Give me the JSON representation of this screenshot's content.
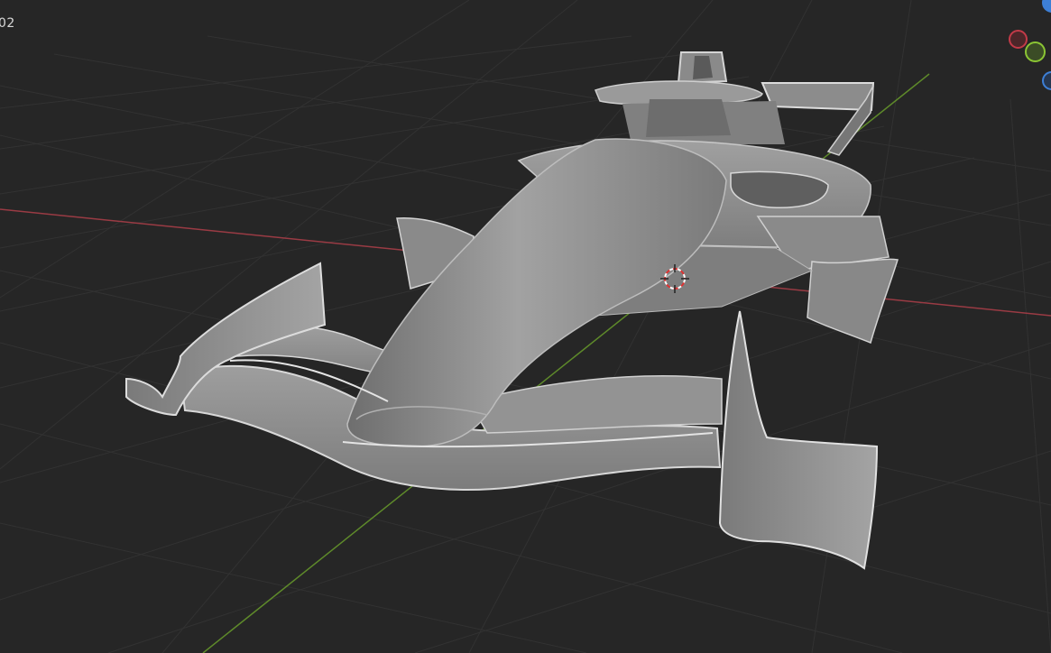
{
  "viewport": {
    "corner_label": "02",
    "background_color": "#262626",
    "grid_color": "#323232",
    "x_axis_color": "#9a3b44",
    "y_axis_color": "#5e8a2a",
    "model_color": "#8f8f8f"
  },
  "gizmo": {
    "x_color": "#c23a48",
    "y_color": "#8bc534",
    "z_color": "#3d7fd6"
  },
  "scene": {
    "object": "F1 car model",
    "cursor": "3d-cursor-icon"
  }
}
